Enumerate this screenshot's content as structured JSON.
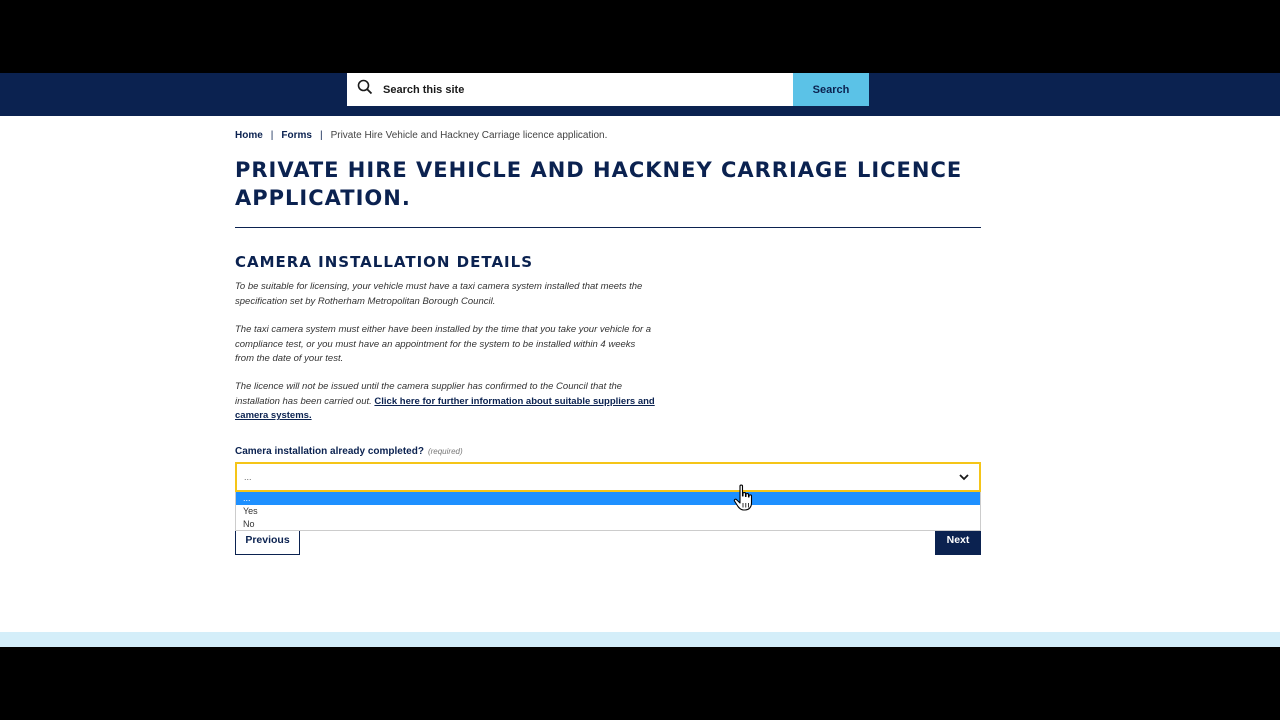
{
  "search": {
    "placeholder": "Search this site",
    "button_label": "Search"
  },
  "breadcrumb": {
    "home": "Home",
    "forms": "Forms",
    "current": "Private Hire Vehicle and Hackney Carriage licence application.",
    "separator": "|"
  },
  "page_title": "PRIVATE HIRE VEHICLE AND HACKNEY CARRIAGE LICENCE APPLICATION.",
  "section_title": "CAMERA INSTALLATION DETAILS",
  "paragraphs": {
    "p1": "To be suitable for licensing, your vehicle must have a taxi camera system installed that meets the specification set by Rotherham Metropolitan Borough Council.",
    "p2": "The taxi camera system must either have been installed by the time that you take your vehicle for a compliance test, or you must have an appointment for the system to be installed within 4 weeks from the date of your test.",
    "p3_text": "The licence will not be issued until the camera supplier has confirmed to the Council that the installation has been carried out.",
    "p3_link": "Click here for further information about suitable suppliers and camera systems."
  },
  "field": {
    "label": "Camera installation already completed?",
    "required": "(required)",
    "value": "...",
    "options": [
      "...",
      "Yes",
      "No"
    ]
  },
  "buttons": {
    "previous": "Previous",
    "next": "Next"
  },
  "colors": {
    "navy": "#0b2250",
    "search_accent": "#5bc2e7",
    "focus_border": "#f5c518",
    "option_highlight": "#1e90ff",
    "footer_strip": "#d4eef9"
  },
  "icons": {
    "search": "search-icon",
    "dropdown": "chevron-down-icon",
    "cursor": "hand-pointer-cursor"
  }
}
